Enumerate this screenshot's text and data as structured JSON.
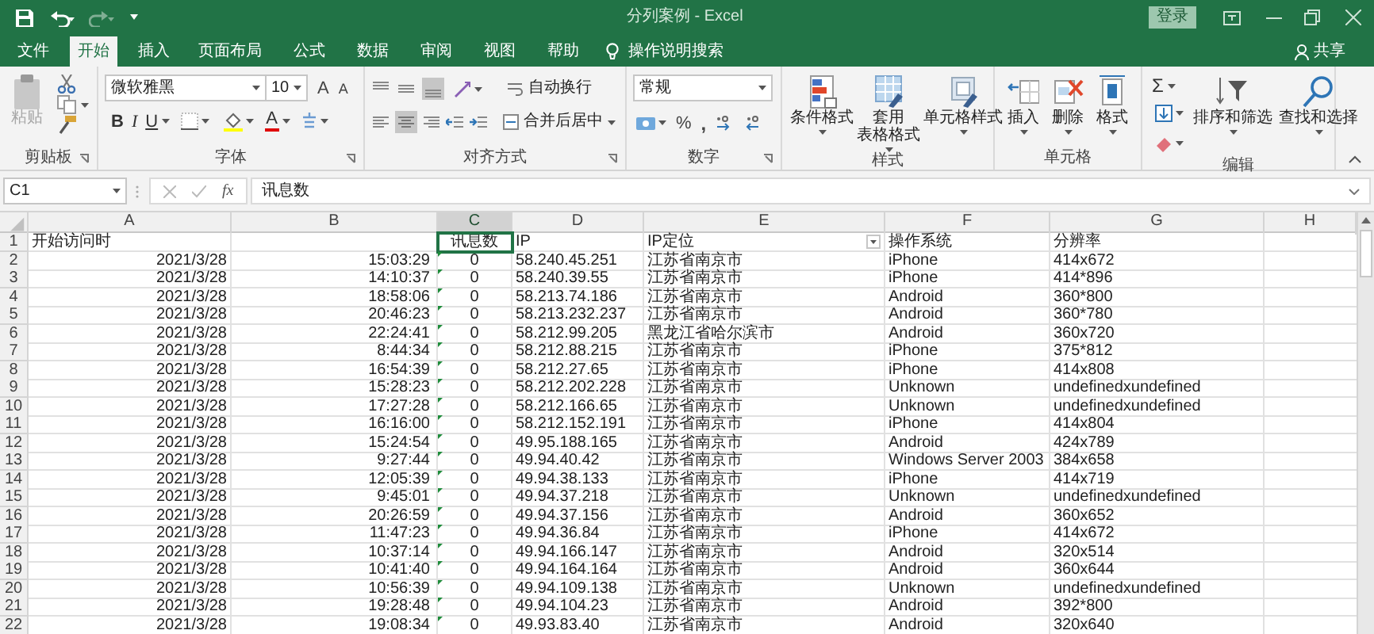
{
  "title_bar": {
    "title": "分列案例 - Excel",
    "sign_in": "登录"
  },
  "tabs": [
    {
      "label": "文件",
      "selected": false
    },
    {
      "label": "开始",
      "selected": true
    },
    {
      "label": "插入",
      "selected": false
    },
    {
      "label": "页面布局",
      "selected": false
    },
    {
      "label": "公式",
      "selected": false
    },
    {
      "label": "数据",
      "selected": false
    },
    {
      "label": "审阅",
      "selected": false
    },
    {
      "label": "视图",
      "selected": false
    },
    {
      "label": "帮助",
      "selected": false
    }
  ],
  "tell_me": "操作说明搜索",
  "share": "共享",
  "ribbon": {
    "clipboard": {
      "group": "剪贴板",
      "paste": {
        "label": "粘贴",
        "disabled": true
      }
    },
    "font": {
      "group": "字体",
      "font_name": "微软雅黑",
      "font_size": "10",
      "grow": "A",
      "shrink": "A",
      "bold": "B",
      "italic": "I",
      "underline": "U",
      "font_color": "A"
    },
    "alignment": {
      "group": "对齐方式",
      "wrap_text": "自动换行",
      "merge_center": "合并后居中"
    },
    "number": {
      "group": "数字",
      "format": "常规",
      "percent": "%",
      "comma": ","
    },
    "styles": {
      "group": "样式",
      "buttons": [
        {
          "lines": [
            "条件格式"
          ]
        },
        {
          "lines": [
            "套用",
            "表格格式"
          ]
        },
        {
          "lines": [
            "单元格样式"
          ]
        }
      ]
    },
    "cells": {
      "group": "单元格",
      "buttons": [
        "插入",
        "删除",
        "格式"
      ]
    },
    "editing": {
      "group": "编辑",
      "autosum": "Σ",
      "buttons": [
        "排序和筛选",
        "查找和选择"
      ]
    }
  },
  "formula_bar": {
    "name_box": "C1",
    "fx": "fx",
    "value": "讯息数"
  },
  "sheet": {
    "columns": [
      {
        "label": "A",
        "selected": false
      },
      {
        "label": "B",
        "selected": false
      },
      {
        "label": "C",
        "selected": true
      },
      {
        "label": "D",
        "selected": false
      },
      {
        "label": "E",
        "selected": false
      },
      {
        "label": "F",
        "selected": false
      },
      {
        "label": "G",
        "selected": false
      },
      {
        "label": "H",
        "selected": false
      }
    ],
    "header_row": {
      "number": "1",
      "cells": [
        {
          "text": "开始访问时",
          "filter": false
        },
        {
          "filter": false
        },
        {
          "text": "讯息数",
          "filter": false
        },
        {
          "text": "IP",
          "filter": false
        },
        {
          "text": "IP定位",
          "filter": true
        },
        {
          "text": "操作系统",
          "filter": false
        },
        {
          "text": "分辨率",
          "filter": false
        }
      ]
    },
    "rows": [
      {
        "number": "2",
        "error_flag": true,
        "cells": [
          "2021/3/28",
          "15:03:29",
          "0",
          "58.240.45.251",
          "江苏省南京市",
          "iPhone",
          "414x672"
        ]
      },
      {
        "number": "3",
        "error_flag": true,
        "cells": [
          "2021/3/28",
          "14:10:37",
          "0",
          "58.240.39.55",
          "江苏省南京市",
          "iPhone",
          "414*896"
        ]
      },
      {
        "number": "4",
        "error_flag": true,
        "cells": [
          "2021/3/28",
          "18:58:06",
          "0",
          "58.213.74.186",
          "江苏省南京市",
          "Android",
          "360*800"
        ]
      },
      {
        "number": "5",
        "error_flag": true,
        "cells": [
          "2021/3/28",
          "20:46:23",
          "0",
          "58.213.232.237",
          "江苏省南京市",
          "Android",
          "360*780"
        ]
      },
      {
        "number": "6",
        "error_flag": true,
        "cells": [
          "2021/3/28",
          "22:24:41",
          "0",
          "58.212.99.205",
          "黑龙江省哈尔滨市",
          "Android",
          "360x720"
        ]
      },
      {
        "number": "7",
        "error_flag": true,
        "cells": [
          "2021/3/28",
          "8:44:34",
          "0",
          "58.212.88.215",
          "江苏省南京市",
          "iPhone",
          "375*812"
        ]
      },
      {
        "number": "8",
        "error_flag": true,
        "cells": [
          "2021/3/28",
          "16:54:39",
          "0",
          "58.212.27.65",
          "江苏省南京市",
          "iPhone",
          "414x808"
        ]
      },
      {
        "number": "9",
        "error_flag": true,
        "cells": [
          "2021/3/28",
          "15:28:23",
          "0",
          "58.212.202.228",
          "江苏省南京市",
          "Unknown",
          "undefinedxundefined"
        ]
      },
      {
        "number": "10",
        "error_flag": true,
        "cells": [
          "2021/3/28",
          "17:27:28",
          "0",
          "58.212.166.65",
          "江苏省南京市",
          "Unknown",
          "undefinedxundefined"
        ]
      },
      {
        "number": "11",
        "error_flag": true,
        "cells": [
          "2021/3/28",
          "16:16:00",
          "0",
          "58.212.152.191",
          "江苏省南京市",
          "iPhone",
          "414x804"
        ]
      },
      {
        "number": "12",
        "error_flag": true,
        "cells": [
          "2021/3/28",
          "15:24:54",
          "0",
          "49.95.188.165",
          "江苏省南京市",
          "Android",
          "424x789"
        ]
      },
      {
        "number": "13",
        "error_flag": true,
        "cells": [
          "2021/3/28",
          "9:27:44",
          "0",
          "49.94.40.42",
          "江苏省南京市",
          "Windows Server 2003",
          "384x658"
        ]
      },
      {
        "number": "14",
        "error_flag": true,
        "cells": [
          "2021/3/28",
          "12:05:39",
          "0",
          "49.94.38.133",
          "江苏省南京市",
          "iPhone",
          "414x719"
        ]
      },
      {
        "number": "15",
        "error_flag": true,
        "cells": [
          "2021/3/28",
          "9:45:01",
          "0",
          "49.94.37.218",
          "江苏省南京市",
          "Unknown",
          "undefinedxundefined"
        ]
      },
      {
        "number": "16",
        "error_flag": true,
        "cells": [
          "2021/3/28",
          "20:26:59",
          "0",
          "49.94.37.156",
          "江苏省南京市",
          "Android",
          "360x652"
        ]
      },
      {
        "number": "17",
        "error_flag": true,
        "cells": [
          "2021/3/28",
          "11:47:23",
          "0",
          "49.94.36.84",
          "江苏省南京市",
          "iPhone",
          "414x672"
        ]
      },
      {
        "number": "18",
        "error_flag": true,
        "cells": [
          "2021/3/28",
          "10:37:14",
          "0",
          "49.94.166.147",
          "江苏省南京市",
          "Android",
          "320x514"
        ]
      },
      {
        "number": "19",
        "error_flag": true,
        "cells": [
          "2021/3/28",
          "10:41:40",
          "0",
          "49.94.164.164",
          "江苏省南京市",
          "Android",
          "360x644"
        ]
      },
      {
        "number": "20",
        "error_flag": true,
        "cells": [
          "2021/3/28",
          "10:56:39",
          "0",
          "49.94.109.138",
          "江苏省南京市",
          "Unknown",
          "undefinedxundefined"
        ]
      },
      {
        "number": "21",
        "error_flag": true,
        "cells": [
          "2021/3/28",
          "19:28:48",
          "0",
          "49.94.104.23",
          "江苏省南京市",
          "Android",
          "392*800"
        ]
      },
      {
        "number": "22",
        "error_flag": true,
        "cells": [
          "2021/3/28",
          "19:08:34",
          "0",
          "49.93.83.40",
          "江苏省南京市",
          "Android",
          "320x640"
        ]
      }
    ]
  }
}
